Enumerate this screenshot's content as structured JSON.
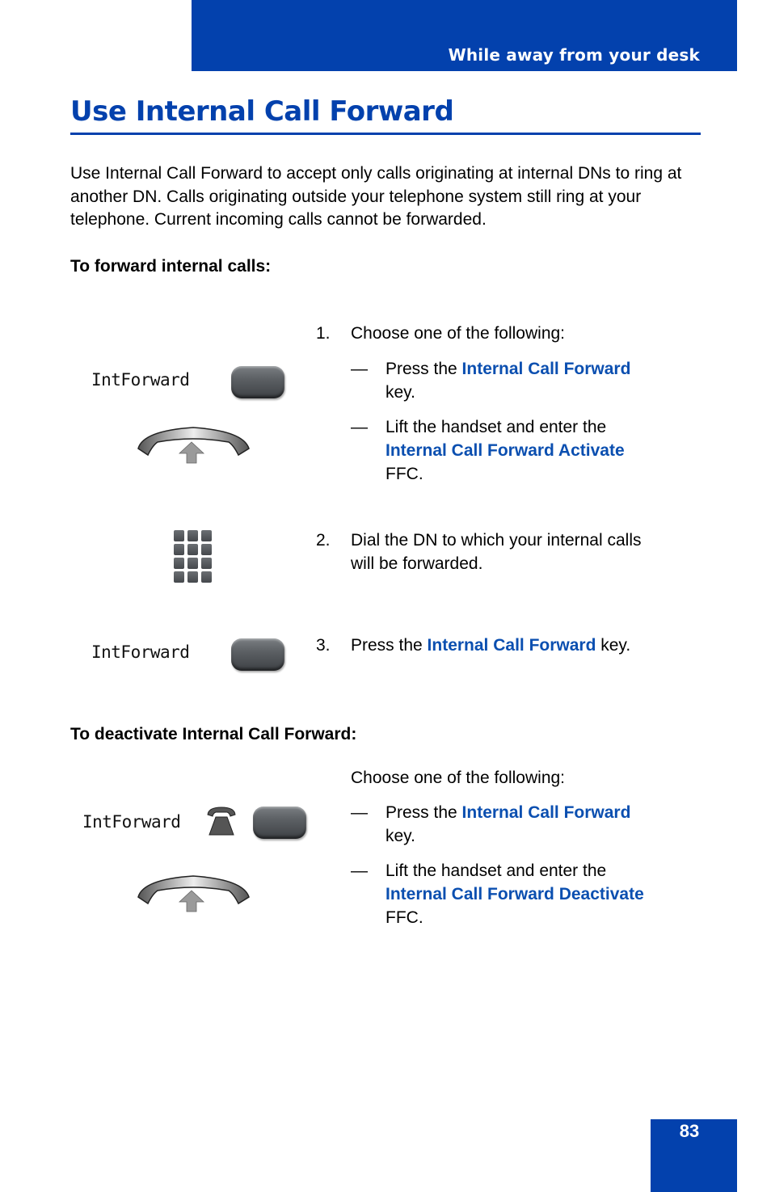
{
  "header": {
    "section_title": "While away from your desk"
  },
  "page": {
    "title": "Use Internal Call Forward",
    "intro": "Use Internal Call Forward to accept only calls originating at internal DNs to ring at another DN. Calls originating outside your telephone system still ring at your telephone. Current incoming calls cannot be forwarded.",
    "page_number": "83"
  },
  "forward_section": {
    "heading": "To forward internal calls:",
    "steps": [
      {
        "number": "1.",
        "text": "Choose one of the following:",
        "options": [
          {
            "dash": "—",
            "pre": "Press the ",
            "highlight": "Internal Call Forward",
            "post_line": "key."
          },
          {
            "dash": "—",
            "pre": "Lift the handset and enter the",
            "highlight": "Internal Call Forward Activate",
            "post_line": "FFC."
          }
        ]
      },
      {
        "number": "2.",
        "line1": "Dial the DN to which your internal calls",
        "line2": "will be forwarded."
      },
      {
        "number": "3.",
        "pre": "Press the ",
        "highlight": "Internal Call Forward",
        "post": " key."
      }
    ],
    "icons": {
      "lcd_label": "IntForward"
    }
  },
  "deactivate_section": {
    "heading": "To deactivate Internal Call Forward:",
    "text": "Choose one of the following:",
    "options": [
      {
        "dash": "—",
        "pre": "Press the ",
        "highlight": "Internal Call Forward",
        "post_line": "key."
      },
      {
        "dash": "—",
        "pre": "Lift the handset and enter the",
        "highlight": "Internal Call Forward Deactivate",
        "post_line": "FFC."
      }
    ],
    "icons": {
      "lcd_label": "IntForward"
    }
  },
  "colors": {
    "brand_blue": "#0341ad",
    "highlight_blue": "#0b4fb0"
  }
}
